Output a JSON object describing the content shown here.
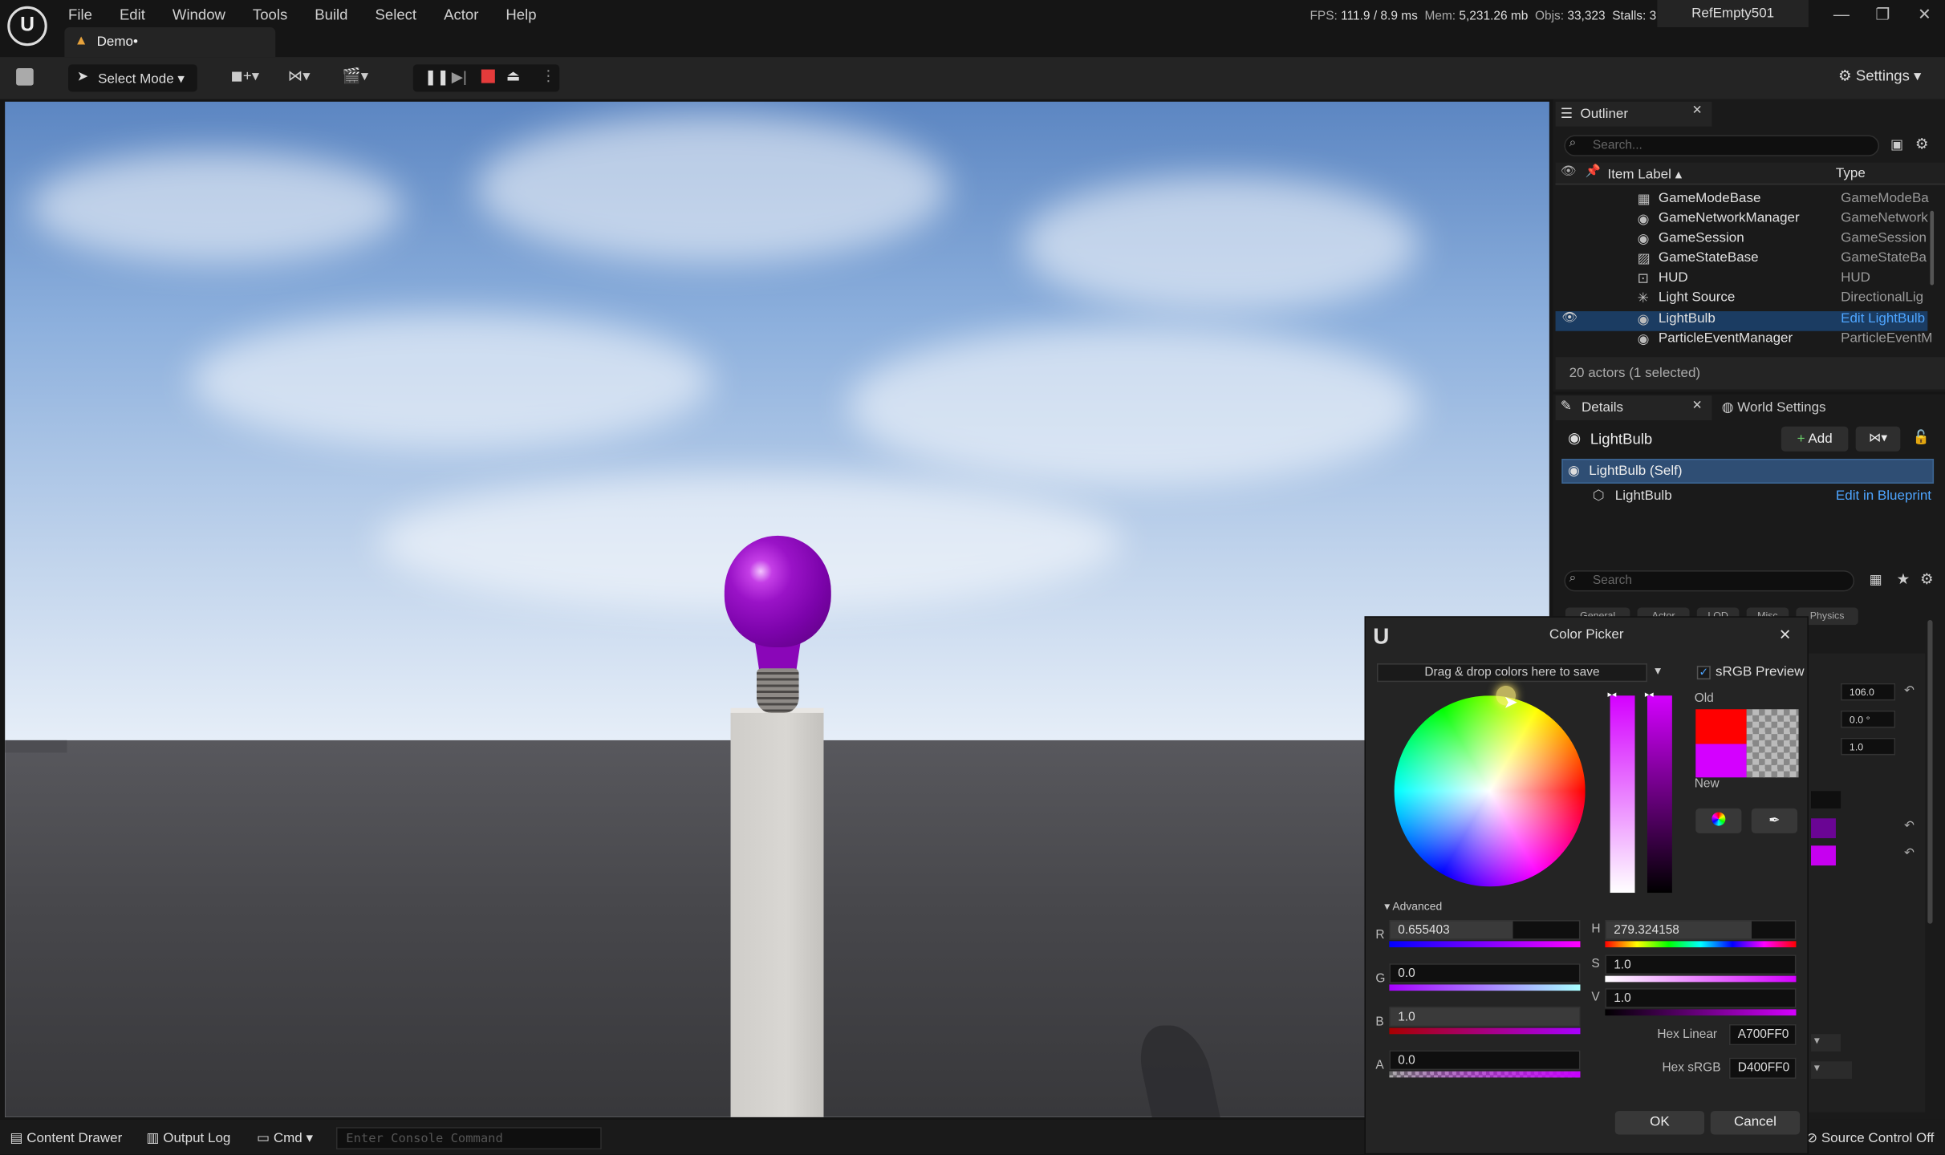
{
  "menu": {
    "items": [
      "File",
      "Edit",
      "Window",
      "Tools",
      "Build",
      "Select",
      "Actor",
      "Help"
    ]
  },
  "stats": {
    "fps_label": "FPS:",
    "fps": "111.9",
    "ms": "/ 8.9 ms",
    "mem_label": "Mem:",
    "mem": "5,231.26 mb",
    "objs_label": "Objs:",
    "objs": "33,323",
    "stalls": "Stalls: 3"
  },
  "project": "RefEmpty501",
  "level_tab": "Demo•",
  "toolbar": {
    "mode": "Select Mode",
    "settings": "Settings"
  },
  "outliner": {
    "title": "Outliner",
    "search_placeholder": "Search...",
    "col_label": "Item Label",
    "col_type": "Type",
    "rows": [
      {
        "label": "GameModeBase",
        "type": "GameModeBa"
      },
      {
        "label": "GameNetworkManager",
        "type": "GameNetwork"
      },
      {
        "label": "GameSession",
        "type": "GameSession"
      },
      {
        "label": "GameStateBase",
        "type": "GameStateBa"
      },
      {
        "label": "HUD",
        "type": "HUD"
      },
      {
        "label": "Light Source",
        "type": "DirectionalLig"
      },
      {
        "label": "LightBulb",
        "type": "Edit LightBulb"
      },
      {
        "label": "ParticleEventManager",
        "type": "ParticleEventM"
      }
    ],
    "count": "20 actors (1 selected)"
  },
  "details": {
    "tab": "Details",
    "world_tab": "World Settings",
    "actor": "LightBulb",
    "add": "Add",
    "self": "LightBulb (Self)",
    "component": "LightBulb",
    "edit_bp": "Edit in Blueprint",
    "search_placeholder": "Search",
    "filters": [
      "General",
      "Actor",
      "LOD",
      "Misc",
      "Physics"
    ],
    "values": [
      "106.0",
      "0.0 °",
      "1.0"
    ]
  },
  "statusbar": {
    "drawer": "Content Drawer",
    "log": "Output Log",
    "cmd": "Cmd",
    "console_placeholder": "Enter Console Command",
    "source": "Source Control Off"
  },
  "picker": {
    "title": "Color Picker",
    "dropzone": "Drag & drop colors here to save",
    "srgb": "sRGB Preview",
    "old": "Old",
    "new": "New",
    "advanced": "Advanced",
    "r_label": "R",
    "r": "0.655403",
    "g_label": "G",
    "g": "0.0",
    "b_label": "B",
    "b": "1.0",
    "a_label": "A",
    "a": "0.0",
    "h_label": "H",
    "h": "279.324158",
    "s_label": "S",
    "s": "1.0",
    "v_label": "V",
    "v": "1.0",
    "hex_linear_label": "Hex Linear",
    "hex_linear": "A700FF0",
    "hex_srgb_label": "Hex sRGB",
    "hex_srgb": "D400FF0",
    "ok": "OK",
    "cancel": "Cancel",
    "old_color": "#ff0000",
    "new_color": "#d400ff"
  }
}
